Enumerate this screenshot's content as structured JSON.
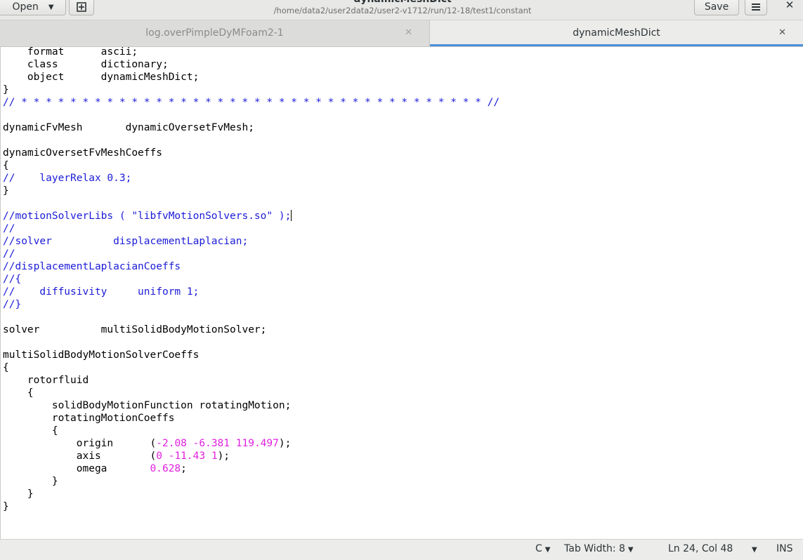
{
  "header": {
    "open_label": "Open",
    "title": "dynamicMeshDict",
    "subtitle": "/home/data2/user2data2/user2-v1712/run/12-18/test1/constant",
    "save_label": "Save",
    "icons": {
      "new": "new-document-icon",
      "menu": "hamburger-menu-icon",
      "close": "close-icon"
    }
  },
  "tabs": [
    {
      "label": "log.overPimpleDyMFoam2-1",
      "active": false
    },
    {
      "label": "dynamicMeshDict",
      "active": true
    }
  ],
  "colors": {
    "comment": "#1b1bd8",
    "number": "#e021e0",
    "tab_indicator": "#4a90d9"
  },
  "lines": [
    [
      {
        "t": "    format      ascii;"
      }
    ],
    [
      {
        "t": "    class       dictionary;"
      }
    ],
    [
      {
        "t": "    object      dynamicMeshDict;"
      }
    ],
    [
      {
        "t": "}"
      }
    ],
    [
      {
        "t": "// * * * * * * * * * * * * * * * * * * * * * * * * * * * * * * * * * * * * * * //",
        "c": "cmt"
      }
    ],
    [],
    [
      {
        "t": "dynamicFvMesh       dynamicOversetFvMesh;"
      }
    ],
    [],
    [
      {
        "t": "dynamicOversetFvMeshCoeffs"
      }
    ],
    [
      {
        "t": "{"
      }
    ],
    [
      {
        "t": "//    layerRelax 0.3;",
        "c": "cmt"
      }
    ],
    [
      {
        "t": "}"
      }
    ],
    [],
    [
      {
        "t": "//motionSolverLibs ( \"libfvMotionSolvers.so\" );",
        "c": "cmt"
      }
    ],
    [
      {
        "t": "//",
        "c": "cmt"
      }
    ],
    [
      {
        "t": "//solver          displacementLaplacian;",
        "c": "cmt"
      }
    ],
    [
      {
        "t": "//",
        "c": "cmt"
      }
    ],
    [
      {
        "t": "//displacementLaplacianCoeffs",
        "c": "cmt"
      }
    ],
    [
      {
        "t": "//{",
        "c": "cmt"
      }
    ],
    [
      {
        "t": "//    diffusivity     uniform 1;",
        "c": "cmt"
      }
    ],
    [
      {
        "t": "//}",
        "c": "cmt"
      }
    ],
    [],
    [
      {
        "t": "solver          multiSolidBodyMotionSolver;"
      }
    ],
    [],
    [
      {
        "t": "multiSolidBodyMotionSolverCoeffs"
      }
    ],
    [
      {
        "t": "{"
      }
    ],
    [
      {
        "t": "    rotorfluid"
      }
    ],
    [
      {
        "t": "    {"
      }
    ],
    [
      {
        "t": "        solidBodyMotionFunction rotatingMotion;"
      }
    ],
    [
      {
        "t": "        rotatingMotionCoeffs"
      }
    ],
    [
      {
        "t": "        {"
      }
    ],
    [
      {
        "t": "            origin      ("
      },
      {
        "t": "-2.08",
        "c": "num"
      },
      {
        "t": " "
      },
      {
        "t": "-6.381",
        "c": "num"
      },
      {
        "t": " "
      },
      {
        "t": "119.497",
        "c": "num"
      },
      {
        "t": ");"
      }
    ],
    [
      {
        "t": "            axis        ("
      },
      {
        "t": "0",
        "c": "num"
      },
      {
        "t": " "
      },
      {
        "t": "-11.43",
        "c": "num"
      },
      {
        "t": " "
      },
      {
        "t": "1",
        "c": "num"
      },
      {
        "t": ");"
      }
    ],
    [
      {
        "t": "            omega       "
      },
      {
        "t": "0.628",
        "c": "num"
      },
      {
        "t": ";"
      }
    ],
    [
      {
        "t": "        }"
      }
    ],
    [
      {
        "t": "    }"
      }
    ],
    [
      {
        "t": "}"
      }
    ],
    [],
    [],
    [
      {
        "t": "// ************************************************************************* //",
        "c": "cmt"
      }
    ]
  ],
  "status": {
    "language": "C",
    "tab_width": "Tab Width: 8",
    "position": "Ln 24, Col 48",
    "mode": "INS"
  }
}
